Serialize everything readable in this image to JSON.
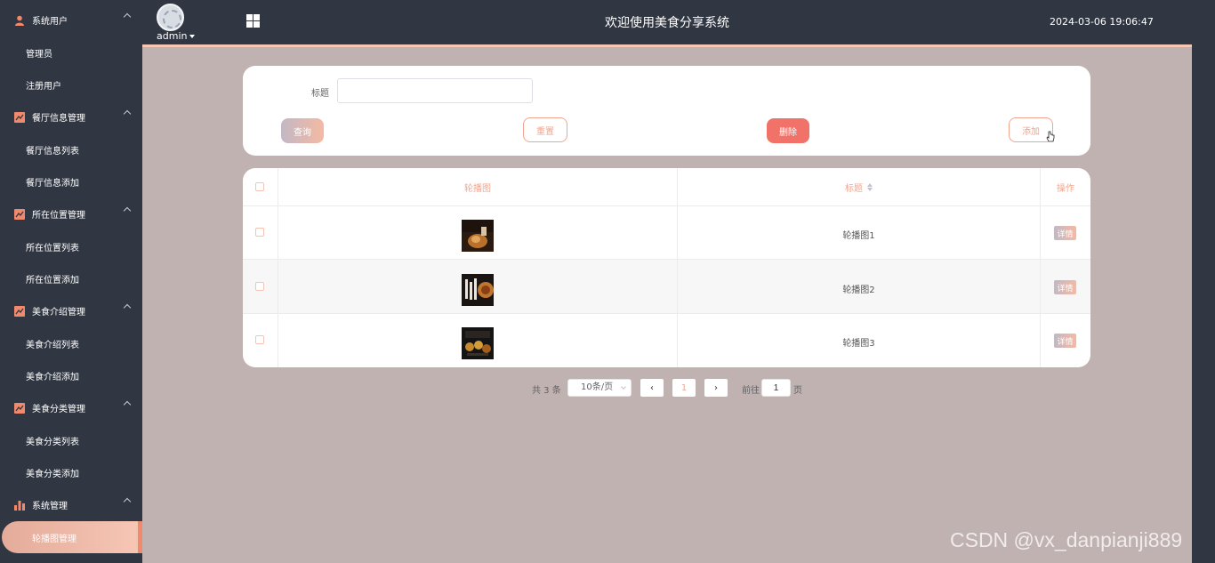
{
  "header": {
    "username": "admin",
    "title": "欢迎使用美食分享系统",
    "datetime": "2024-03-06 19:06:47"
  },
  "sidebar": {
    "groups": [
      {
        "label": "系统用户",
        "icon": "user-icon",
        "items": [
          "管理员",
          "注册用户"
        ]
      },
      {
        "label": "餐厅信息管理",
        "icon": "chart-line-icon",
        "items": [
          "餐厅信息列表",
          "餐厅信息添加"
        ]
      },
      {
        "label": "所在位置管理",
        "icon": "chart-line-icon",
        "items": [
          "所在位置列表",
          "所在位置添加"
        ]
      },
      {
        "label": "美食介绍管理",
        "icon": "chart-line-icon",
        "items": [
          "美食介绍列表",
          "美食介绍添加"
        ]
      },
      {
        "label": "美食分类管理",
        "icon": "chart-line-icon",
        "items": [
          "美食分类列表",
          "美食分类添加"
        ]
      },
      {
        "label": "系统管理",
        "icon": "bar-chart-icon",
        "items": [
          "轮播图管理"
        ]
      }
    ],
    "active_item": "轮播图管理",
    "accent": "#f18a6d"
  },
  "search": {
    "label": "标题",
    "value": "",
    "placeholder": "",
    "buttons": {
      "query": "查询",
      "reset": "重置",
      "delete": "删除",
      "add": "添加"
    }
  },
  "table": {
    "columns": [
      "轮播图",
      "标题",
      "操作"
    ],
    "rows": [
      {
        "title": "轮播图1",
        "action": "详情"
      },
      {
        "title": "轮播图2",
        "action": "详情"
      },
      {
        "title": "轮播图3",
        "action": "详情"
      }
    ]
  },
  "pagination": {
    "total": "共 3 条",
    "page_size": "10条/页",
    "current_page": "1",
    "goto_label": "前往",
    "goto_value": "1",
    "goto_unit": "页"
  },
  "watermark": "CSDN @vx_danpianji889"
}
